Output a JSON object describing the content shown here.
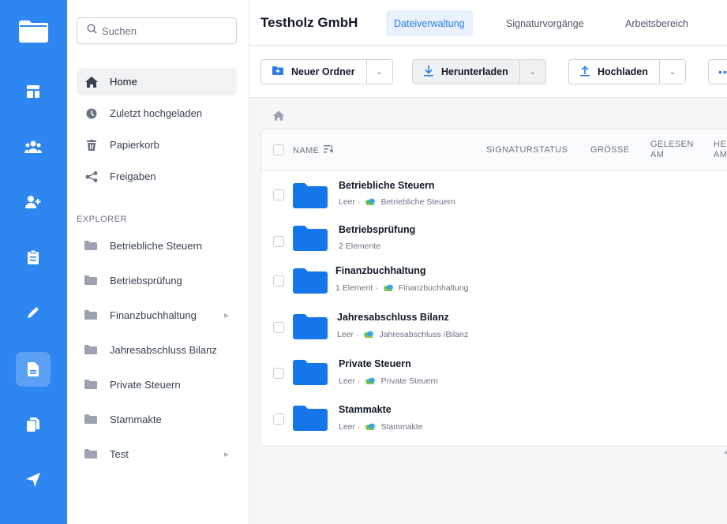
{
  "rail": {
    "icons": [
      "folder-app-icon",
      "dashboard-icon",
      "team-icon",
      "add-user-icon",
      "clipboard-icon",
      "pen-icon",
      "document-icon",
      "copy-icon",
      "send-icon"
    ],
    "active": "document-icon",
    "color": "#2e86f0"
  },
  "sidebar": {
    "search_placeholder": "Suchen",
    "nav": [
      {
        "label": "Home",
        "icon": "home-icon",
        "active": true
      },
      {
        "label": "Zuletzt hochgeladen",
        "icon": "clock-icon"
      },
      {
        "label": "Papierkorb",
        "icon": "trash-icon"
      },
      {
        "label": "Freigaben",
        "icon": "share-icon"
      }
    ],
    "explorer_label": "EXPLORER",
    "explorer": [
      {
        "label": "Betriebliche Steuern"
      },
      {
        "label": "Betriebsprüfung"
      },
      {
        "label": "Finanzbuchhaltung",
        "expandable": true
      },
      {
        "label": "Jahresabschluss Bilanz"
      },
      {
        "label": "Private Steuern"
      },
      {
        "label": "Stammakte"
      },
      {
        "label": "Test",
        "expandable": true
      }
    ]
  },
  "header": {
    "company": "Testholz GmbH",
    "tabs": [
      {
        "label": "Dateiverwaltung",
        "active": true
      },
      {
        "label": "Signaturvorgänge"
      },
      {
        "label": "Arbeitsbereich"
      }
    ]
  },
  "toolbar": {
    "new_folder": "Neuer Ordner",
    "download": "Herunterladen",
    "upload": "Hochladen",
    "more": "••"
  },
  "table": {
    "columns": {
      "name": "NAME",
      "signature_status": "SIGNATURSTATUS",
      "size": "GRÖSSE",
      "read_on_1": "GELESEN",
      "read_on_2": "AM",
      "he_1": "HE",
      "he_2": "AM"
    },
    "rows": [
      {
        "name": "Betriebliche Steuern",
        "meta": "Leer ·",
        "path": "Betriebliche Steuern"
      },
      {
        "name": "Betriebsprüfung",
        "meta": "2 Elemente",
        "path": ""
      },
      {
        "name": "Finanzbuchhaltung",
        "meta": "1 Element ·",
        "path": "Finanzbuchhaltung"
      },
      {
        "name": "Jahresabschluss Bilanz",
        "meta": "Leer ·",
        "path": "Jahresabschluss /Bilanz"
      },
      {
        "name": "Private Steuern",
        "meta": "Leer ·",
        "path": "Private Steuern"
      },
      {
        "name": "Stammakte",
        "meta": "Leer ·",
        "path": "Stammakte"
      }
    ]
  }
}
